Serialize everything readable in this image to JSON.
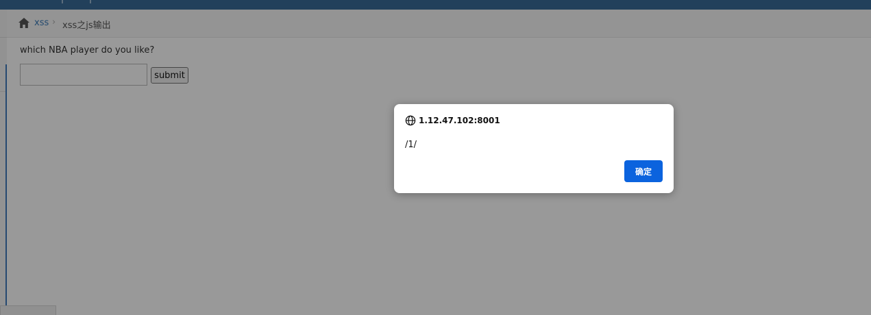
{
  "breadcrumb": {
    "home_icon": "home-icon",
    "separator_icon": "chevron-right-icon",
    "items": [
      {
        "label": "xss"
      },
      {
        "label": "xss之js输出"
      }
    ]
  },
  "form": {
    "question": "which NBA player do you like?",
    "input_value": "",
    "submit_label": "submit"
  },
  "alert": {
    "origin_icon": "globe-icon",
    "origin": "1.12.47.102:8001",
    "message": "/1/",
    "ok_label": "确定"
  },
  "colors": {
    "accent": "#3a6b98",
    "link": "#3a7ab8",
    "dialog_button": "#0b63de"
  }
}
